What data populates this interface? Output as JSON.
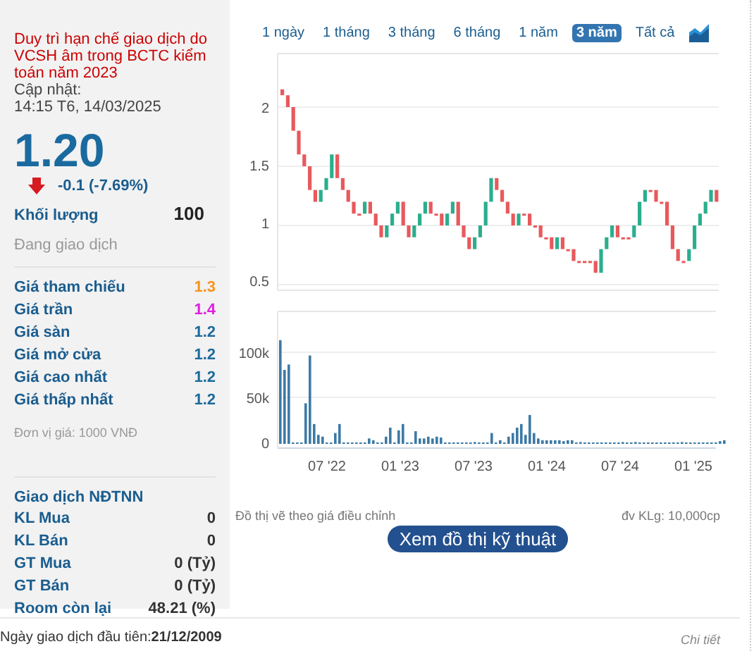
{
  "notice": "Duy trì hạn chế giao dịch do VCSH âm trong BCTC kiểm toán năm 2023",
  "updated_label": "Cập nhật:",
  "updated_time": "14:15 T6, 14/03/2025",
  "price": "1.20",
  "change": {
    "falling": true,
    "text": "-0.1 (-7.69%)"
  },
  "volume": {
    "label": "Khối lượng",
    "value": "100"
  },
  "status": "Đang giao dịch",
  "prices": [
    {
      "label": "Giá tham chiếu",
      "value": "1.3",
      "color": "#f7941d"
    },
    {
      "label": "Giá trần",
      "value": "1.4",
      "color": "#e01ee0"
    },
    {
      "label": "Giá sàn",
      "value": "1.2",
      "color": "#1b6a9c"
    },
    {
      "label": "Giá mở cửa",
      "value": "1.2",
      "color": "#1b6a9c"
    },
    {
      "label": "Giá cao nhất",
      "value": "1.2",
      "color": "#1b6a9c"
    },
    {
      "label": "Giá thấp nhất",
      "value": "1.2",
      "color": "#1b6a9c"
    }
  ],
  "unit_note": "Đơn vị giá: 1000 VNĐ",
  "foreign": {
    "title": "Giao dịch NĐTNN",
    "rows": [
      {
        "label": "KL Mua",
        "value": "0"
      },
      {
        "label": "KL Bán",
        "value": "0"
      },
      {
        "label": "GT Mua",
        "value": "0 (Tỷ)"
      },
      {
        "label": "GT Bán",
        "value": "0 (Tỷ)"
      },
      {
        "label": "Room còn lại",
        "value": "48.21 (%)"
      }
    ]
  },
  "ranges": [
    {
      "label": "1 ngày",
      "selected": false
    },
    {
      "label": "1 tháng",
      "selected": false
    },
    {
      "label": "3 tháng",
      "selected": false
    },
    {
      "label": "6 tháng",
      "selected": false
    },
    {
      "label": "1 năm",
      "selected": false
    },
    {
      "label": "3 năm",
      "selected": true
    },
    {
      "label": "Tất cả",
      "selected": false
    }
  ],
  "price_axis": [
    "2",
    "1.5",
    "1",
    "0.5"
  ],
  "volume_axis": [
    "100k",
    "50k",
    "0"
  ],
  "x_labels": [
    "07 '22",
    "01 '23",
    "07 '23",
    "01 '24",
    "07 '24",
    "01 '25"
  ],
  "chart_note": "Đồ thị vẽ theo giá điều chỉnh",
  "volume_unit": "đv KLg: 10,000cp",
  "tech_button": "Xem đồ thị kỹ thuật",
  "first_trade": {
    "label": "Ngày giao dịch đầu tiên:",
    "date": "21/12/2009"
  },
  "detail_link": "Chi tiết"
}
